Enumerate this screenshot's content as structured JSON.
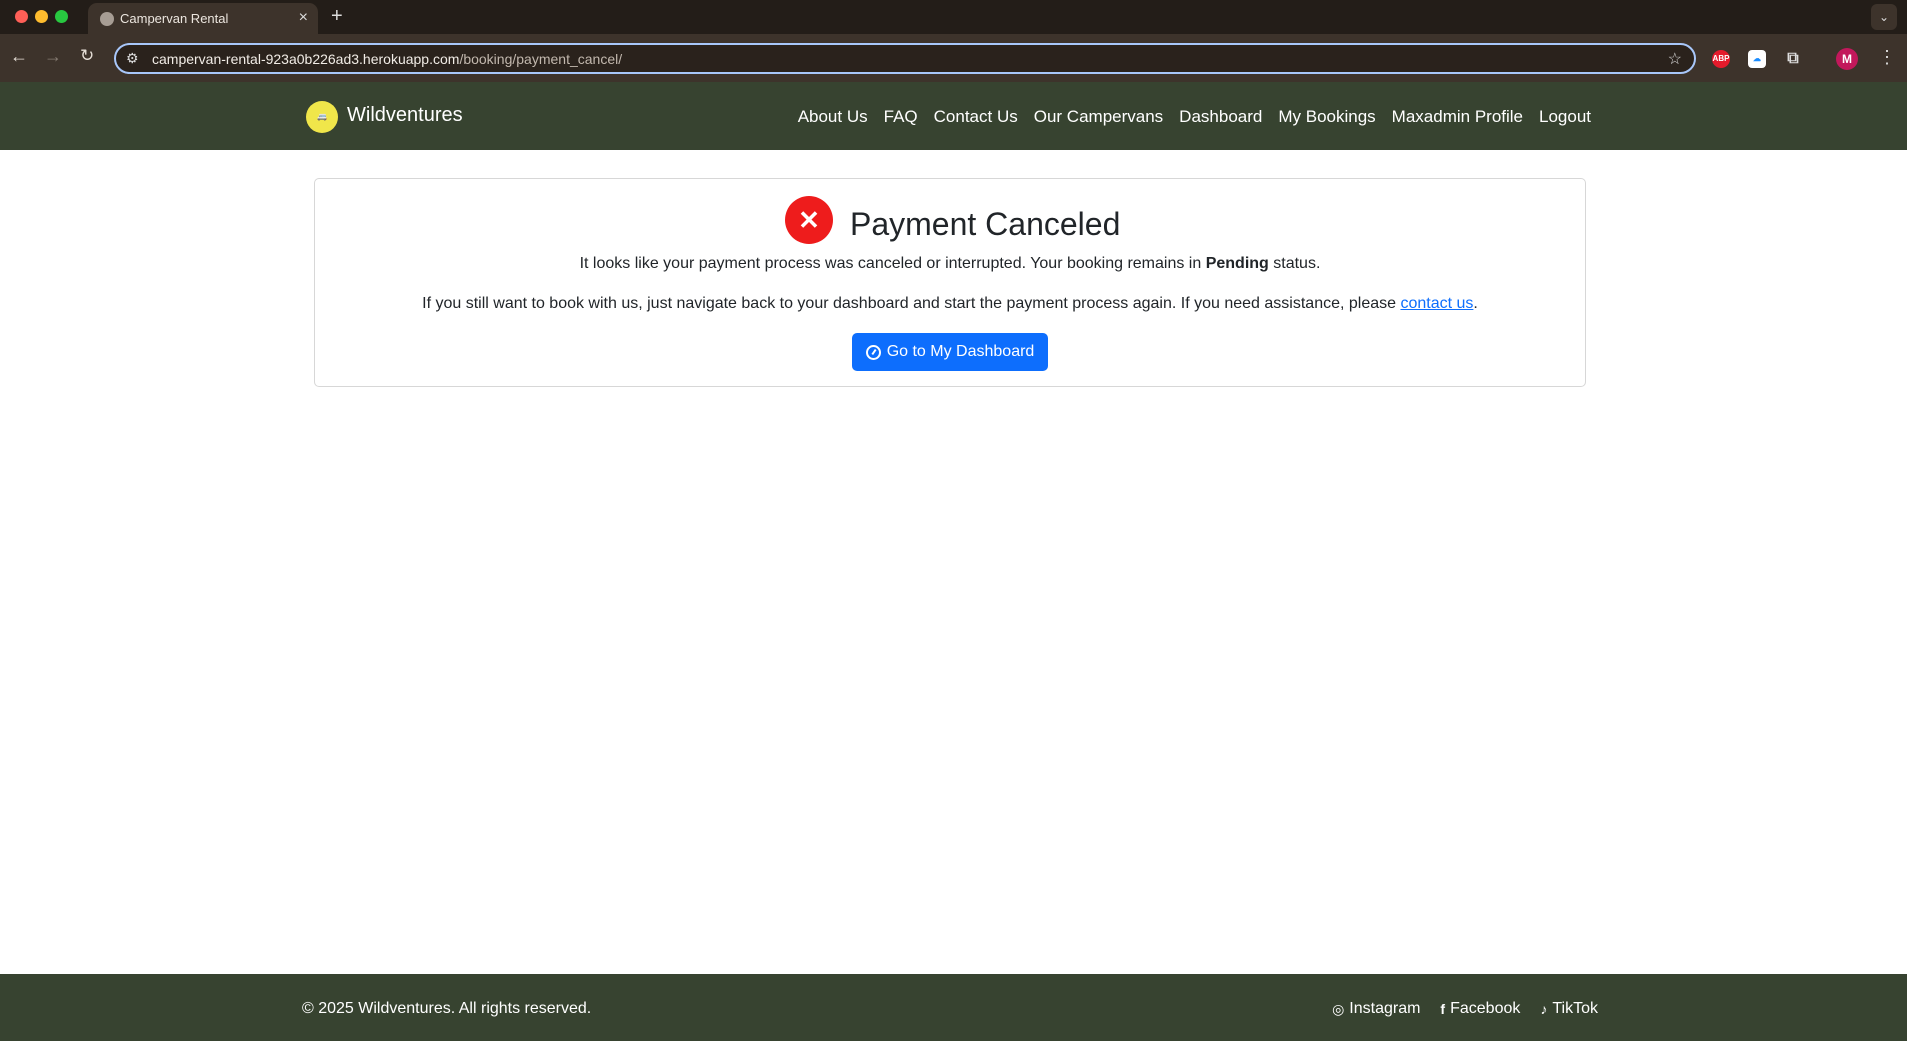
{
  "browser": {
    "tab_title": "Campervan Rental",
    "tab_close": "×",
    "new_tab": "+",
    "url_host": "campervan-rental-923a0b226ad3.herokuapp.com",
    "url_path": "/booking/payment_cancel/",
    "profile_initial": "M",
    "abp_label": "ABP"
  },
  "site": {
    "brand": "Wildventures",
    "nav": [
      "About Us",
      "FAQ",
      "Contact Us",
      "Our Campervans",
      "Dashboard",
      "My Bookings",
      "Maxadmin Profile",
      "Logout"
    ]
  },
  "main": {
    "title": "Payment Canceled",
    "line1_before": "It looks like your payment process was canceled or interrupted. Your booking remains in ",
    "line1_bold": "Pending",
    "line1_after": " status.",
    "line2_before": "If you still want to book with us, just navigate back to your dashboard and start the payment process again. If you need assistance, please ",
    "line2_link": "contact us",
    "line2_after": ".",
    "button_label": "Go to My Dashboard",
    "status_color": "#ee1c1c",
    "button_color": "#0d6efd"
  },
  "footer": {
    "copyright": "© 2025 Wildventures. All rights reserved.",
    "social": [
      {
        "label": "Instagram",
        "icon": "instagram-icon"
      },
      {
        "label": "Facebook",
        "icon": "facebook-icon"
      },
      {
        "label": "TikTok",
        "icon": "tiktok-icon"
      }
    ]
  },
  "theme": {
    "nav_bg": "#374330"
  }
}
